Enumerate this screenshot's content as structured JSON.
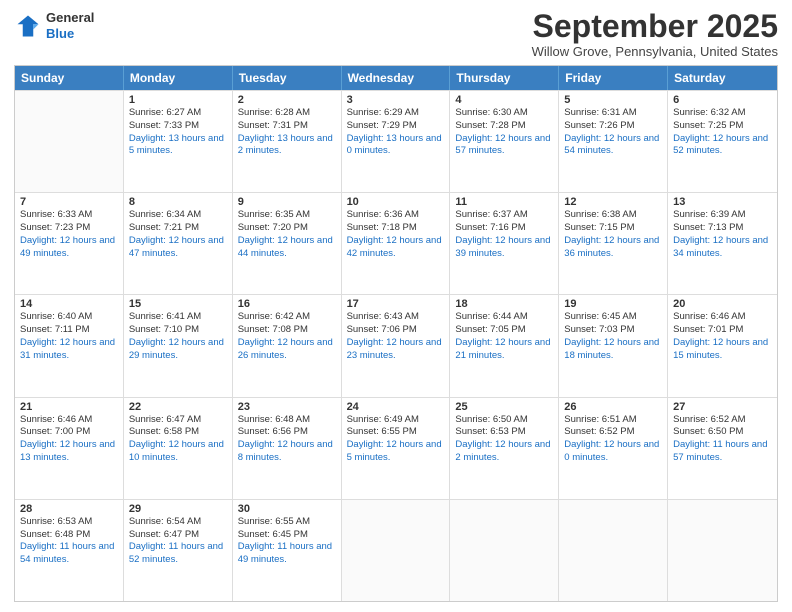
{
  "header": {
    "logo": {
      "general": "General",
      "blue": "Blue"
    },
    "title": "September 2025",
    "location": "Willow Grove, Pennsylvania, United States"
  },
  "calendar": {
    "days_of_week": [
      "Sunday",
      "Monday",
      "Tuesday",
      "Wednesday",
      "Thursday",
      "Friday",
      "Saturday"
    ],
    "rows": [
      [
        {
          "day": "",
          "sunrise": "",
          "sunset": "",
          "daylight": ""
        },
        {
          "day": "1",
          "sunrise": "Sunrise: 6:27 AM",
          "sunset": "Sunset: 7:33 PM",
          "daylight": "Daylight: 13 hours and 5 minutes."
        },
        {
          "day": "2",
          "sunrise": "Sunrise: 6:28 AM",
          "sunset": "Sunset: 7:31 PM",
          "daylight": "Daylight: 13 hours and 2 minutes."
        },
        {
          "day": "3",
          "sunrise": "Sunrise: 6:29 AM",
          "sunset": "Sunset: 7:29 PM",
          "daylight": "Daylight: 13 hours and 0 minutes."
        },
        {
          "day": "4",
          "sunrise": "Sunrise: 6:30 AM",
          "sunset": "Sunset: 7:28 PM",
          "daylight": "Daylight: 12 hours and 57 minutes."
        },
        {
          "day": "5",
          "sunrise": "Sunrise: 6:31 AM",
          "sunset": "Sunset: 7:26 PM",
          "daylight": "Daylight: 12 hours and 54 minutes."
        },
        {
          "day": "6",
          "sunrise": "Sunrise: 6:32 AM",
          "sunset": "Sunset: 7:25 PM",
          "daylight": "Daylight: 12 hours and 52 minutes."
        }
      ],
      [
        {
          "day": "7",
          "sunrise": "Sunrise: 6:33 AM",
          "sunset": "Sunset: 7:23 PM",
          "daylight": "Daylight: 12 hours and 49 minutes."
        },
        {
          "day": "8",
          "sunrise": "Sunrise: 6:34 AM",
          "sunset": "Sunset: 7:21 PM",
          "daylight": "Daylight: 12 hours and 47 minutes."
        },
        {
          "day": "9",
          "sunrise": "Sunrise: 6:35 AM",
          "sunset": "Sunset: 7:20 PM",
          "daylight": "Daylight: 12 hours and 44 minutes."
        },
        {
          "day": "10",
          "sunrise": "Sunrise: 6:36 AM",
          "sunset": "Sunset: 7:18 PM",
          "daylight": "Daylight: 12 hours and 42 minutes."
        },
        {
          "day": "11",
          "sunrise": "Sunrise: 6:37 AM",
          "sunset": "Sunset: 7:16 PM",
          "daylight": "Daylight: 12 hours and 39 minutes."
        },
        {
          "day": "12",
          "sunrise": "Sunrise: 6:38 AM",
          "sunset": "Sunset: 7:15 PM",
          "daylight": "Daylight: 12 hours and 36 minutes."
        },
        {
          "day": "13",
          "sunrise": "Sunrise: 6:39 AM",
          "sunset": "Sunset: 7:13 PM",
          "daylight": "Daylight: 12 hours and 34 minutes."
        }
      ],
      [
        {
          "day": "14",
          "sunrise": "Sunrise: 6:40 AM",
          "sunset": "Sunset: 7:11 PM",
          "daylight": "Daylight: 12 hours and 31 minutes."
        },
        {
          "day": "15",
          "sunrise": "Sunrise: 6:41 AM",
          "sunset": "Sunset: 7:10 PM",
          "daylight": "Daylight: 12 hours and 29 minutes."
        },
        {
          "day": "16",
          "sunrise": "Sunrise: 6:42 AM",
          "sunset": "Sunset: 7:08 PM",
          "daylight": "Daylight: 12 hours and 26 minutes."
        },
        {
          "day": "17",
          "sunrise": "Sunrise: 6:43 AM",
          "sunset": "Sunset: 7:06 PM",
          "daylight": "Daylight: 12 hours and 23 minutes."
        },
        {
          "day": "18",
          "sunrise": "Sunrise: 6:44 AM",
          "sunset": "Sunset: 7:05 PM",
          "daylight": "Daylight: 12 hours and 21 minutes."
        },
        {
          "day": "19",
          "sunrise": "Sunrise: 6:45 AM",
          "sunset": "Sunset: 7:03 PM",
          "daylight": "Daylight: 12 hours and 18 minutes."
        },
        {
          "day": "20",
          "sunrise": "Sunrise: 6:46 AM",
          "sunset": "Sunset: 7:01 PM",
          "daylight": "Daylight: 12 hours and 15 minutes."
        }
      ],
      [
        {
          "day": "21",
          "sunrise": "Sunrise: 6:46 AM",
          "sunset": "Sunset: 7:00 PM",
          "daylight": "Daylight: 12 hours and 13 minutes."
        },
        {
          "day": "22",
          "sunrise": "Sunrise: 6:47 AM",
          "sunset": "Sunset: 6:58 PM",
          "daylight": "Daylight: 12 hours and 10 minutes."
        },
        {
          "day": "23",
          "sunrise": "Sunrise: 6:48 AM",
          "sunset": "Sunset: 6:56 PM",
          "daylight": "Daylight: 12 hours and 8 minutes."
        },
        {
          "day": "24",
          "sunrise": "Sunrise: 6:49 AM",
          "sunset": "Sunset: 6:55 PM",
          "daylight": "Daylight: 12 hours and 5 minutes."
        },
        {
          "day": "25",
          "sunrise": "Sunrise: 6:50 AM",
          "sunset": "Sunset: 6:53 PM",
          "daylight": "Daylight: 12 hours and 2 minutes."
        },
        {
          "day": "26",
          "sunrise": "Sunrise: 6:51 AM",
          "sunset": "Sunset: 6:52 PM",
          "daylight": "Daylight: 12 hours and 0 minutes."
        },
        {
          "day": "27",
          "sunrise": "Sunrise: 6:52 AM",
          "sunset": "Sunset: 6:50 PM",
          "daylight": "Daylight: 11 hours and 57 minutes."
        }
      ],
      [
        {
          "day": "28",
          "sunrise": "Sunrise: 6:53 AM",
          "sunset": "Sunset: 6:48 PM",
          "daylight": "Daylight: 11 hours and 54 minutes."
        },
        {
          "day": "29",
          "sunrise": "Sunrise: 6:54 AM",
          "sunset": "Sunset: 6:47 PM",
          "daylight": "Daylight: 11 hours and 52 minutes."
        },
        {
          "day": "30",
          "sunrise": "Sunrise: 6:55 AM",
          "sunset": "Sunset: 6:45 PM",
          "daylight": "Daylight: 11 hours and 49 minutes."
        },
        {
          "day": "",
          "sunrise": "",
          "sunset": "",
          "daylight": ""
        },
        {
          "day": "",
          "sunrise": "",
          "sunset": "",
          "daylight": ""
        },
        {
          "day": "",
          "sunrise": "",
          "sunset": "",
          "daylight": ""
        },
        {
          "day": "",
          "sunrise": "",
          "sunset": "",
          "daylight": ""
        }
      ]
    ]
  }
}
